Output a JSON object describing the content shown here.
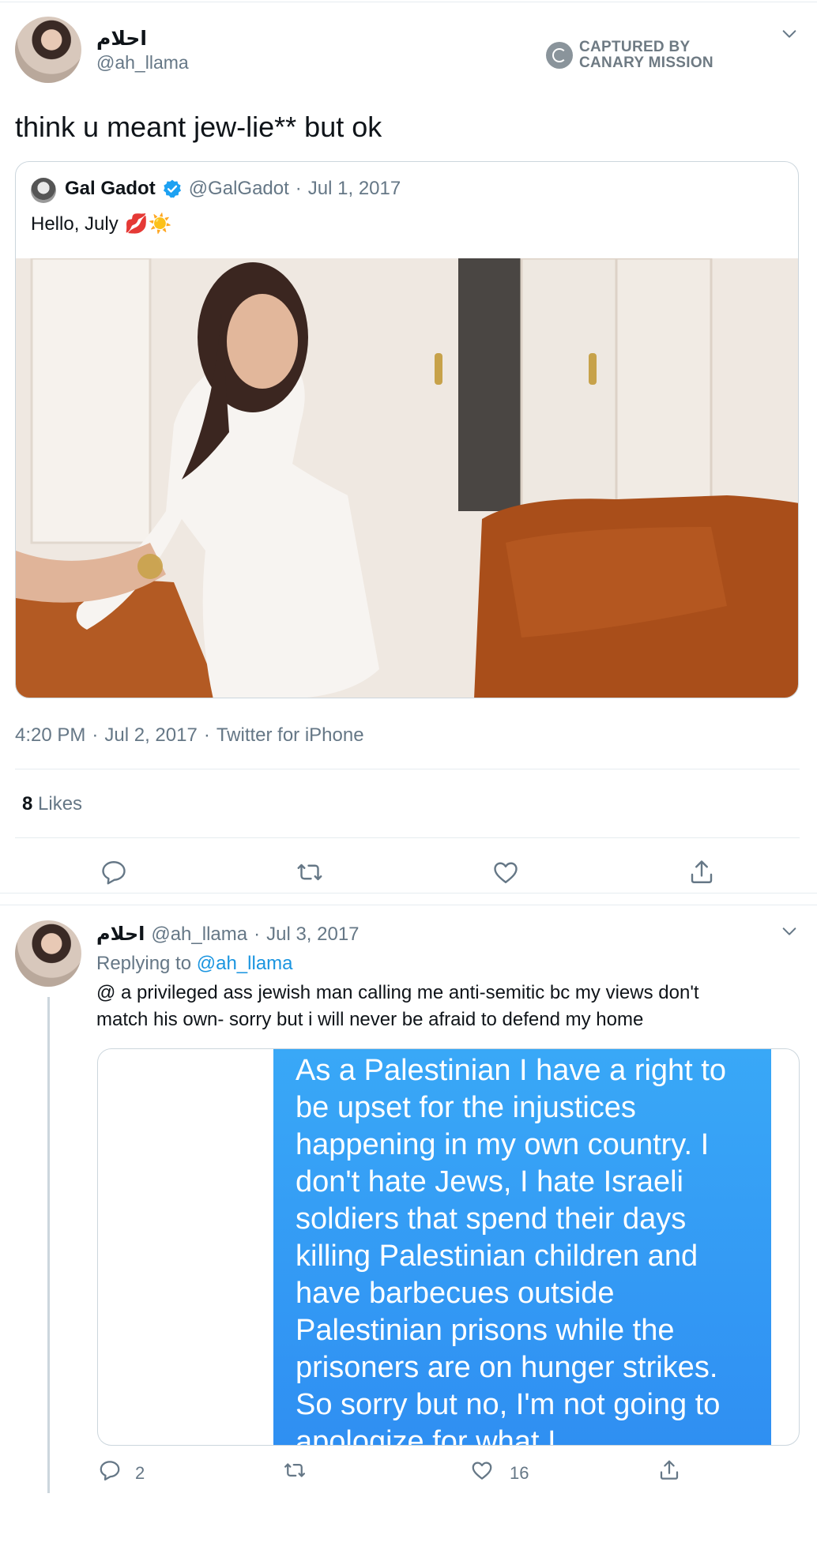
{
  "main_tweet": {
    "author_name": "احلام",
    "author_handle": "@ah_llama",
    "text": "think u meant jew-lie** but ok",
    "watermark": {
      "line1": "CAPTURED BY",
      "line2": "CANARY MISSION"
    },
    "quoted": {
      "author_name": "Gal Gadot",
      "author_handle": "@GalGadot",
      "separator": "·",
      "date": "Jul 1, 2017",
      "text": "Hello, July",
      "emojis": "💋☀️"
    },
    "meta": {
      "time": "4:20 PM",
      "date": "Jul 2, 2017",
      "source": "Twitter for iPhone",
      "sep": "·"
    },
    "likes": {
      "count": "8",
      "label": "Likes"
    }
  },
  "reply_tweet": {
    "author_name": "احلام",
    "author_handle": "@ah_llama",
    "separator": "·",
    "date": "Jul 3, 2017",
    "replying_label": "Replying to",
    "replying_handle": "@ah_llama",
    "text_line1": "@ a privileged ass jewish man calling me anti-semitic bc my views don't",
    "text_line2": "match his own- sorry but i will never be afraid to defend my home",
    "image_text": "As a Palestinian I have a right to be upset for the injustices happening in my own country. I don't hate Jews, I hate Israeli soldiers that spend their days killing Palestinian children and have barbecues outside Palestinian prisons while the prisoners are on hunger strikes. So sorry but no, I'm not going to apologize for what I",
    "counts": {
      "replies": "2",
      "likes": "16"
    }
  },
  "colors": {
    "link": "#1b95e0",
    "muted": "#657786",
    "bubble": "#2f8ff2",
    "verified": "#1da1f2"
  }
}
